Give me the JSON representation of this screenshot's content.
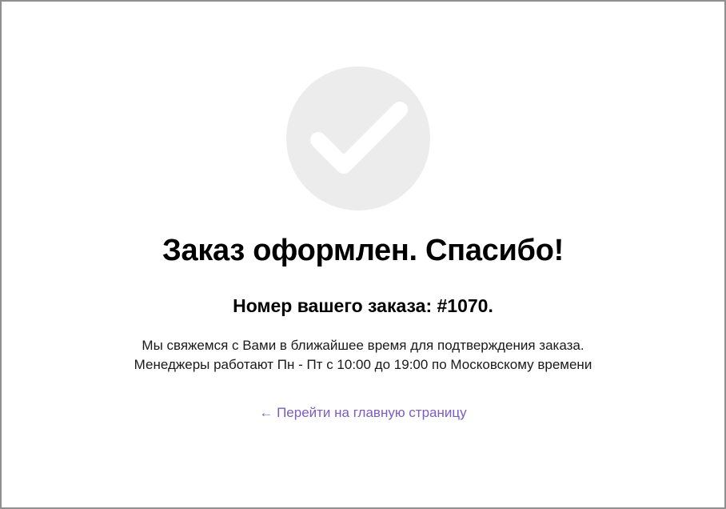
{
  "status": {
    "icon": "checkmark-icon",
    "icon_circle_color": "#ececec",
    "icon_check_color": "#ffffff"
  },
  "title": "Заказ оформлен. Спасибо!",
  "order": {
    "text": "Номер вашего заказа: #1070."
  },
  "info": {
    "line1": "Мы свяжемся с Вами в ближайшее время для подтверждения заказа.",
    "line2": "Менеджеры работают Пн - Пт с 10:00 до 19:00 по Московскому времени"
  },
  "link": {
    "label": "← Перейти на главную страницу",
    "color": "#7b5bc7"
  }
}
